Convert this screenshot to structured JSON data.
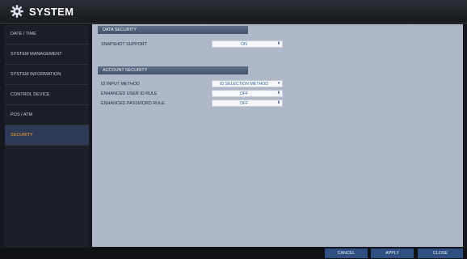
{
  "window": {
    "title": "SYSTEM",
    "icon": "gear-icon"
  },
  "sidebar": {
    "items": [
      {
        "label": "DATE / TIME"
      },
      {
        "label": "SYSTEM MANAGEMENT"
      },
      {
        "label": "SYSTEM INFORMATION"
      },
      {
        "label": "CONTROL DEVICE"
      },
      {
        "label": "POS / ATM"
      },
      {
        "label": "SECURITY"
      }
    ],
    "active": "SECURITY"
  },
  "data_security": {
    "header": "DATA SECURITY",
    "snapshot_support": {
      "label": "SNAPSHOT SUPPORT",
      "value": "ON"
    }
  },
  "account_security": {
    "header": "ACCOUNT SECURITY",
    "id_input_method": {
      "label": "ID INPUT METHOD",
      "value": "ID SELECTION METHOD"
    },
    "enhanced_user_id_rule": {
      "label": "ENHANCED USER ID RULE",
      "value": "OFF"
    },
    "enhanced_password_rule": {
      "label": "ENHANCED PASSWORD RULE",
      "value": "OFF"
    }
  },
  "buttons": {
    "cancel": "CANCEL",
    "apply": "APPLY",
    "close": "CLOSE"
  },
  "colors": {
    "accent": "#f0a030",
    "button": "#2f4f82",
    "panel": "#aeb8c8",
    "header": "#45536b"
  }
}
